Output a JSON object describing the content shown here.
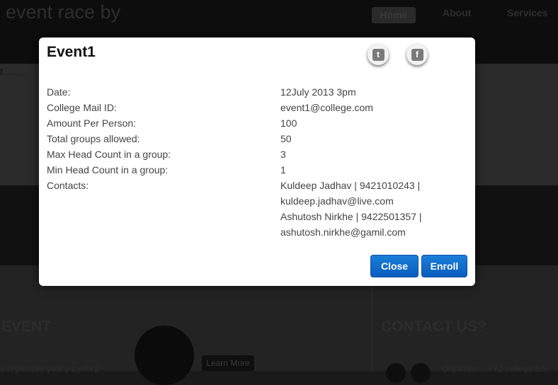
{
  "background": {
    "logo": "event race by",
    "nav": [
      "Home",
      "About",
      "Services"
    ],
    "dots": "t........",
    "section_left": "EVENT",
    "section_right": "CONTACT US?",
    "left_text": "e organized yearly by XYZ",
    "right_text": "Organizer - XYZ college Enr",
    "learn_more": "Learn More"
  },
  "modal": {
    "title": "Event1",
    "twitter_glyph": "t",
    "facebook_glyph": "f",
    "details": [
      {
        "label": "Date:",
        "value": "12July 2013 3pm"
      },
      {
        "label": "College Mail ID:",
        "value": "event1@college.com"
      },
      {
        "label": "Amount Per Person:",
        "value": "100"
      },
      {
        "label": "Total groups allowed:",
        "value": "50"
      },
      {
        "label": "Max Head Count in a group:",
        "value": "3"
      },
      {
        "label": "Min Head Count in a group:",
        "value": "1"
      },
      {
        "label": "Contacts:",
        "value": "Kuldeep Jadhav | 9421010243 |"
      }
    ],
    "contacts_extra": [
      "kuldeep.jadhav@live.com",
      "Ashutosh Nirkhe | 9422501357 |",
      "ashutosh.nirkhe@gamil.com"
    ],
    "close_label": "Close",
    "enroll_label": "Enroll"
  },
  "colors": {
    "primary_button": "#0a6ad0",
    "overlay": "#1a1a1a"
  }
}
